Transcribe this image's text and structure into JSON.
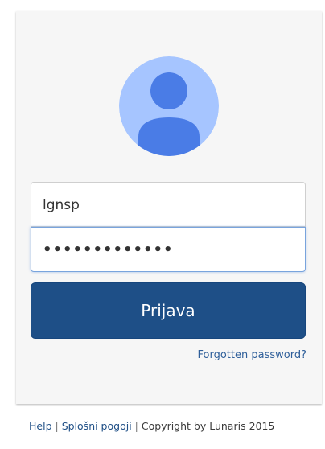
{
  "login": {
    "avatar_icon": "user-avatar-icon",
    "username_value": "lgnsp",
    "password_masked_value": "•••••••••••••",
    "submit_label": "Prijava",
    "forgot_password_label": "Forgotten password?"
  },
  "footer": {
    "help_label": "Help",
    "separator_1": "|",
    "terms_label": "Splošni pogoji",
    "separator_2": "|",
    "copyright_text": "Copyright by Lunaris 2015"
  },
  "colors": {
    "card_background": "#f6f6f6",
    "button_background": "#1e4f87",
    "link": "#1f4f86",
    "avatar_background": "#a6c5ff",
    "avatar_figure": "#4a7ce6"
  }
}
